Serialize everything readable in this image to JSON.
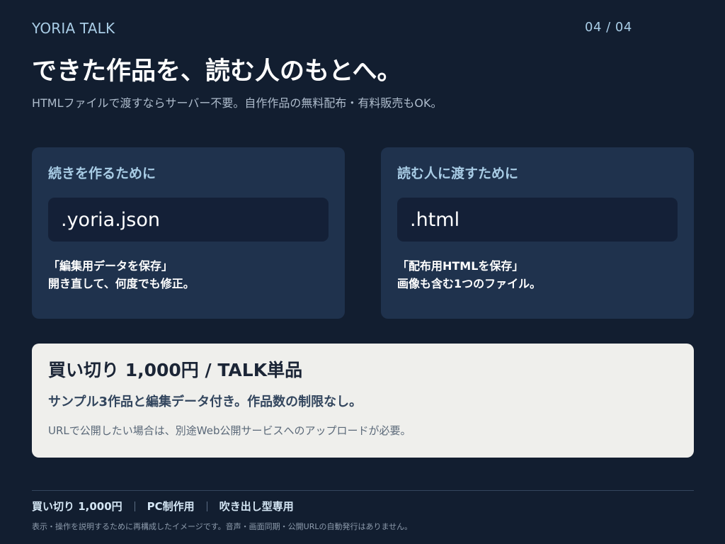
{
  "header": {
    "brand": "YORIA TALK",
    "page_indicator": "04 / 04",
    "title": "できた作品を、読む人のもとへ。",
    "subtitle": "HTMLファイルで渡すならサーバー不要。自作作品の無料配布・有料販売もOK。"
  },
  "cards": [
    {
      "heading": "続きを作るために",
      "file_ext": ".yoria.json",
      "desc_line1": "「編集用データを保存」",
      "desc_line2": "開き直して、何度でも修正。"
    },
    {
      "heading": "読む人に渡すために",
      "file_ext": ".html",
      "desc_line1": "「配布用HTMLを保存」",
      "desc_line2": "画像も含む1つのファイル。"
    }
  ],
  "plan": {
    "title": "買い切り 1,000円 / TALK単品",
    "subtitle": "サンプル3作品と編集データ付き。作品数の制限なし。",
    "note": "URLで公開したい場合は、別途Web公開サービスへのアップロードが必要。"
  },
  "footer": {
    "tags": [
      "買い切り 1,000円",
      "PC制作用",
      "吹き出し型専用"
    ],
    "disclaimer": "表示・操作を説明するために再構成したイメージです。音声・画面同期・公開URLの自動発行はありません。"
  },
  "colors": {
    "background": "#121e30",
    "card": "#1f324d",
    "accent": "#a9cde6",
    "plan_panel": "#efefec"
  }
}
